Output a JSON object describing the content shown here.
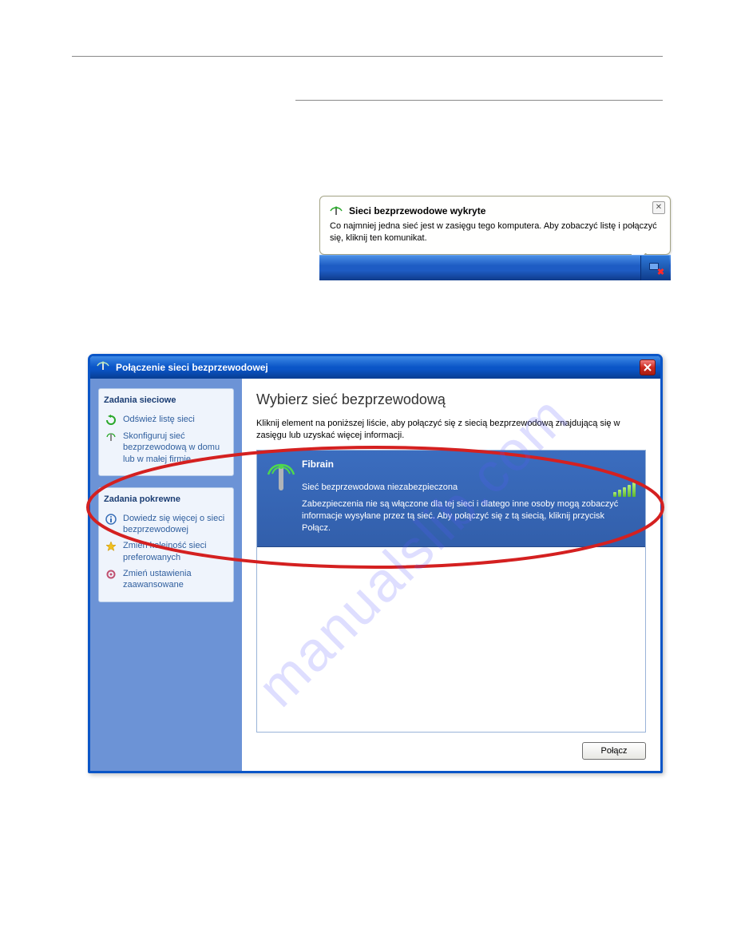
{
  "balloon": {
    "title": "Sieci bezprzewodowe wykryte",
    "body": "Co najmniej jedna sieć jest w zasięgu tego komputera. Aby zobaczyć listę i połączyć się, kliknij ten komunikat."
  },
  "window": {
    "title": "Połączenie sieci bezprzewodowej"
  },
  "sidebar": {
    "panel1_title": "Zadania sieciowe",
    "panel1_items": [
      "Odśwież listę sieci",
      "Skonfiguruj sieć bezprzewodową w domu lub w małej firmie"
    ],
    "panel2_title": "Zadania pokrewne",
    "panel2_items": [
      "Dowiedz się więcej o sieci bezprzewodowej",
      "Zmień kolejność sieci preferowanych",
      "Zmień ustawienia zaawansowane"
    ]
  },
  "main": {
    "heading": "Wybierz sieć bezprzewodową",
    "subtext": "Kliknij element na poniższej liście, aby połączyć się z siecią bezprzewodową znajdującą się w zasięgu lub uzyskać więcej informacji.",
    "network": {
      "ssid": "Fibrain",
      "status": "Sieć bezprzewodowa niezabezpieczona",
      "description": "Zabezpieczenia nie są włączone dla tej sieci i dlatego inne osoby mogą zobaczyć informacje wysyłane przez tą sieć. Aby połączyć się z tą siecią, kliknij przycisk Połącz."
    },
    "connect_button": "Połącz"
  },
  "watermark": "manualslib.com"
}
